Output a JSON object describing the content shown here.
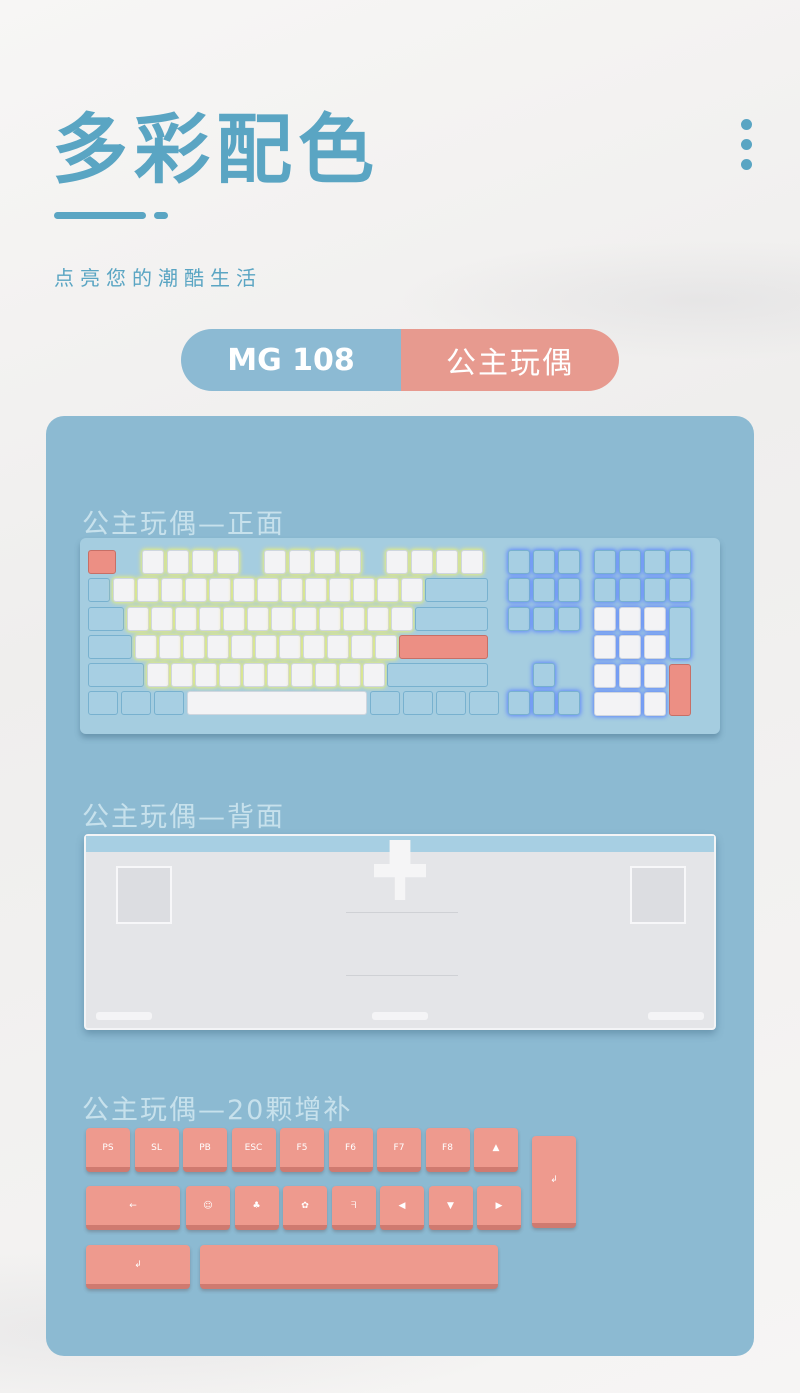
{
  "header": {
    "title": "多彩配色",
    "subtitle": "点亮您的潮酷生活"
  },
  "switcher": {
    "model": "MG 108",
    "color_scheme": "公主玩偶"
  },
  "sections": {
    "front_label": "公主玩偶—正面",
    "back_label": "公主玩偶—背面",
    "extra_label": "公主玩偶—20颗增补"
  },
  "extra_keycaps": {
    "row1": [
      "PS",
      "SL",
      "PB",
      "ESC",
      "F5",
      "F6",
      "F7",
      "F8",
      "▲"
    ],
    "row2": [
      "←",
      "☺",
      "♣",
      "✿",
      "ᖷ",
      "◀",
      "▼",
      "▶"
    ],
    "enter_tall": "↲",
    "row3_enter": "↲"
  },
  "colors": {
    "accent_blue": "#5aa5c3",
    "panel_blue": "#8cbad2",
    "accent_pink": "#e79a8f"
  }
}
